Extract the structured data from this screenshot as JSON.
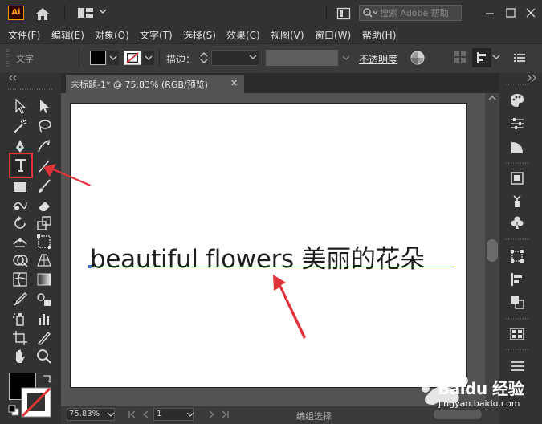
{
  "app": {
    "logo_text": "Ai",
    "search_placeholder": "搜索 Adobe 帮助"
  },
  "menu": [
    "文件(F)",
    "编辑(E)",
    "对象(O)",
    "文字(T)",
    "选择(S)",
    "效果(C)",
    "视图(V)",
    "窗口(W)",
    "帮助(H)"
  ],
  "control_bar": {
    "selection_type": "文字",
    "fill_color": "#000000",
    "stroke_color": "none",
    "stroke_label": "描边：",
    "stroke_weight": "",
    "opacity_label": "不透明度"
  },
  "document": {
    "tab_title": "未标题-1* @ 75.83% (RGB/预览)",
    "tab_close": "✕",
    "artboard_text": "beautiful flowers 美丽的花朵"
  },
  "status_bar": {
    "zoom": "75.83%",
    "page": "1",
    "status_text": "编组选择"
  },
  "tools": {
    "selected": "type-tool",
    "highlight_color": "#e2333a"
  },
  "watermark": {
    "brand": "Baidu 经验",
    "url": "jingyan.baidu.com"
  },
  "annotation_color": "#e2333a"
}
